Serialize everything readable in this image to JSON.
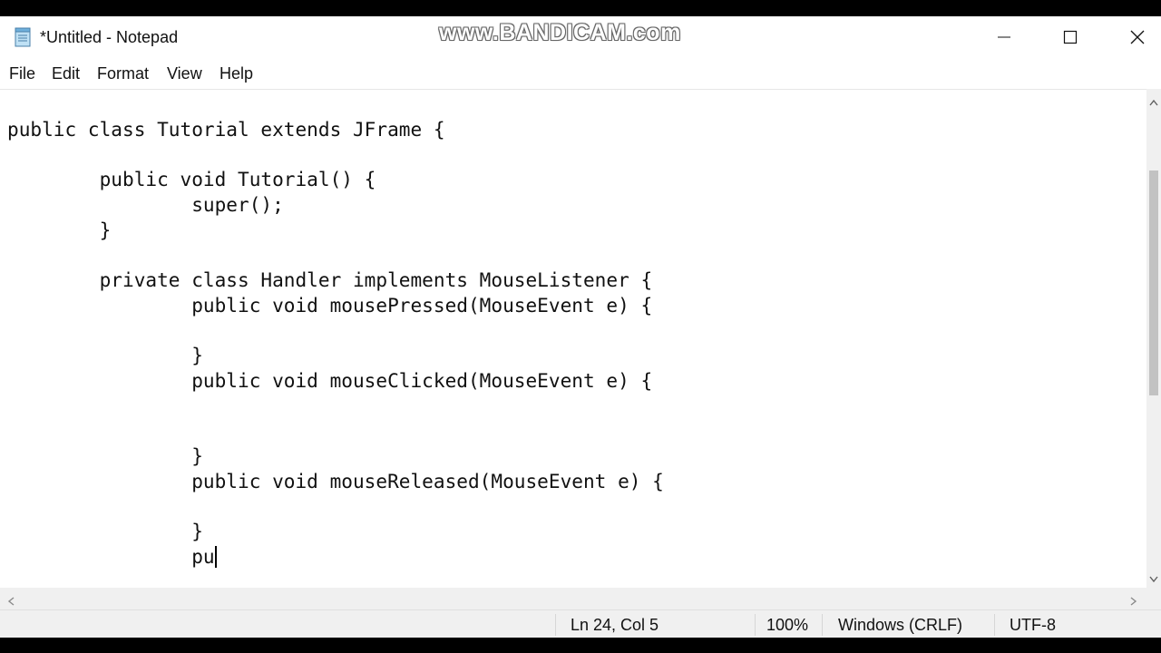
{
  "window": {
    "title": "*Untitled - Notepad",
    "watermark": "www.BANDICAM.com"
  },
  "menu": {
    "items": [
      "File",
      "Edit",
      "Format",
      "View",
      "Help"
    ]
  },
  "editor": {
    "lines": [
      "",
      "public class Tutorial extends JFrame {",
      "",
      "        public void Tutorial() {",
      "                super();",
      "        }",
      "",
      "        private class Handler implements MouseListener {",
      "                public void mousePressed(MouseEvent e) {",
      "",
      "                }",
      "                public void mouseClicked(MouseEvent e) {",
      "",
      "",
      "                }",
      "                public void mouseReleased(MouseEvent e) {",
      "",
      "                }",
      "                pu"
    ]
  },
  "status": {
    "position": "Ln 24, Col 5",
    "zoom": "100%",
    "line_ending": "Windows (CRLF)",
    "encoding": "UTF-8"
  },
  "icons": {
    "app": "notepad-icon",
    "minimize": "minimize-icon",
    "maximize": "maximize-icon",
    "close": "close-icon"
  }
}
